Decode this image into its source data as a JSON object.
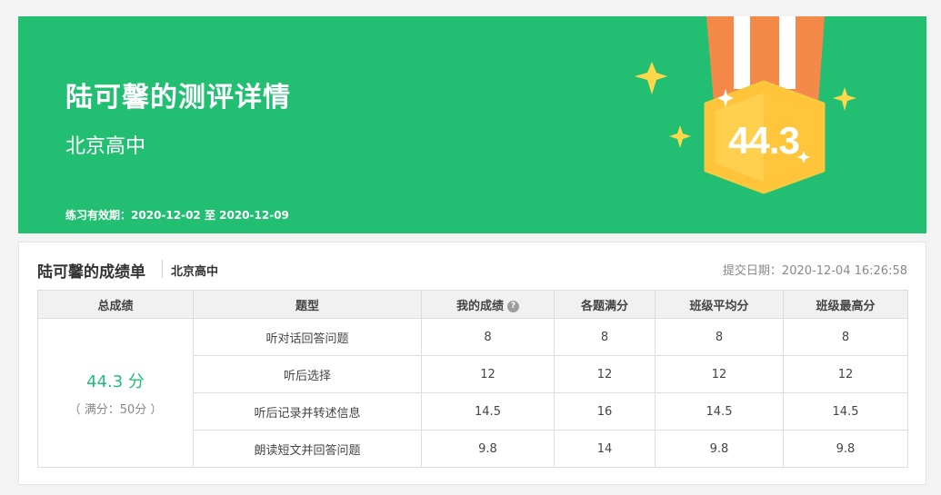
{
  "banner": {
    "title": "陆可馨的测评详情",
    "school": "北京高中",
    "validity_label": "练习有效期：",
    "validity_range": "2020-12-02 至 2020-12-09",
    "medal_score": "44.3",
    "colors": {
      "background": "#22bf73",
      "medal_gold": "#ffc43a",
      "ribbon_orange": "#f5894a"
    }
  },
  "report": {
    "title": "陆可馨的成绩单",
    "school": "北京高中",
    "submit_label": "提交日期：",
    "submit_date": "2020-12-04 16:26:58",
    "columns": [
      "总成绩",
      "题型",
      "我的成绩",
      "各题满分",
      "班级平均分",
      "班级最高分"
    ],
    "help_icon": "question-circle-icon",
    "total": {
      "score": "44.3 分",
      "full": "（ 满分：50分 ）"
    },
    "rows": [
      {
        "type": "听对话回答问题",
        "my": "8",
        "full": "8",
        "avg": "8",
        "max": "8"
      },
      {
        "type": "听后选择",
        "my": "12",
        "full": "12",
        "avg": "12",
        "max": "12"
      },
      {
        "type": "听后记录并转述信息",
        "my": "14.5",
        "full": "16",
        "avg": "14.5",
        "max": "14.5"
      },
      {
        "type": "朗读短文并回答问题",
        "my": "9.8",
        "full": "14",
        "avg": "9.8",
        "max": "9.8"
      }
    ]
  }
}
